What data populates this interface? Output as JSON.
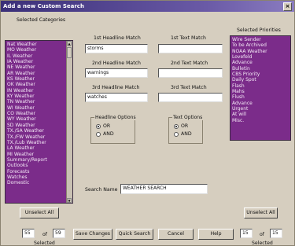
{
  "window": {
    "title": "Add a new Custom Search",
    "close_glyph": "×"
  },
  "categories": {
    "header": "Selected Categories",
    "items": [
      "Nat Weather",
      "MO Weather",
      "IL Weather",
      "IA Weather",
      "NE Weather",
      "AR Weather",
      "KS Weather",
      "OK Weather",
      "IN Weather",
      "KY Weather",
      "TN Weather",
      "WI Weather",
      "CO Weather",
      "WY Weather",
      "SD Weather",
      "TX./SA Weather",
      "TX./FW Weather",
      "TX./Lub Weather",
      "LA Weather",
      "MI Weather",
      "Summary/Report",
      "Outlooks",
      "Forecasts",
      "Watches",
      "Domestic"
    ]
  },
  "priorities": {
    "header": "Selected Priorities",
    "items": [
      "Wire Sender",
      "To be Archived",
      "NOAA Weather",
      "Lovefeld",
      "Advance",
      "Bulletin",
      "CBS Priority",
      "Daily Spot",
      "Flash",
      "Mahs",
      "Flush",
      "Advance",
      "Urgent",
      "At will",
      "Misc."
    ]
  },
  "headlines": {
    "h1_label": "1st Headline Match",
    "h1_value": "storms",
    "h2_label": "2nd Headline Match",
    "h2_value": "warnings",
    "h3_label": "3rd Headline Match",
    "h3_value": "watches",
    "t1_label": "1st Text Match",
    "t1_value": "",
    "t2_label": "2nd Text Match",
    "t2_value": "",
    "t3_label": "3rd Text Match",
    "t3_value": ""
  },
  "headline_options": {
    "title": "Headline Options",
    "or": "OR",
    "and": "AND",
    "selected": "OR"
  },
  "text_options": {
    "title": "Text Options",
    "or": "OR",
    "and": "AND",
    "selected": "OR"
  },
  "search_name": {
    "label": "Search Name",
    "value": "WEATHER SEARCH"
  },
  "buttons": {
    "unselect_left": "Unselect All",
    "unselect_right": "Unselect All",
    "save": "Save Changes",
    "quick": "Quick Search",
    "cancel": "Cancel",
    "help": "Help"
  },
  "left_count": {
    "selected": "55",
    "of": "of",
    "total": "59",
    "caption": "Selected"
  },
  "right_count": {
    "selected": "15",
    "of": "of",
    "total": "15",
    "caption": "Selected"
  }
}
